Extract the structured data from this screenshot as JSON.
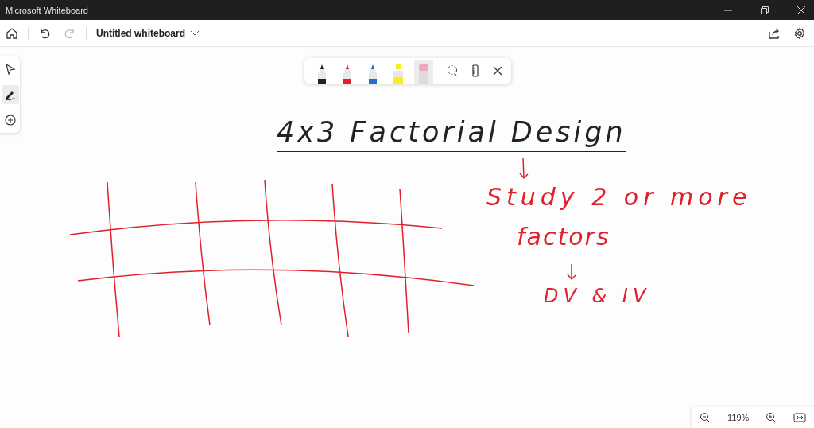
{
  "window": {
    "title": "Microsoft Whiteboard"
  },
  "toolbar": {
    "board_title": "Untitled whiteboard",
    "redo_disabled": true
  },
  "tools": [
    {
      "kind": "select",
      "selected": false
    },
    {
      "kind": "pen",
      "selected": true
    },
    {
      "kind": "add",
      "selected": false
    }
  ],
  "pen_tray": [
    {
      "kind": "pen",
      "color": "#222222",
      "selected": false
    },
    {
      "kind": "pen",
      "color": "#e0202a",
      "selected": false
    },
    {
      "kind": "pen",
      "color": "#1e6fc8",
      "selected": false
    },
    {
      "kind": "highlighter",
      "color": "#f5f01e",
      "selected": false
    },
    {
      "kind": "eraser",
      "color": "#f0a8b8",
      "selected": true
    }
  ],
  "ink_texts": [
    {
      "text": "4x3  Factorial Design",
      "color": "#222222",
      "underline": true
    },
    {
      "text": "Study 2 or more",
      "color": "#e0202a",
      "underline": false
    },
    {
      "text": "factors",
      "color": "#e0202a",
      "underline": false
    },
    {
      "text": "DV & IV",
      "color": "#e0202a",
      "underline": false
    }
  ],
  "zoom": {
    "value": "119%"
  }
}
